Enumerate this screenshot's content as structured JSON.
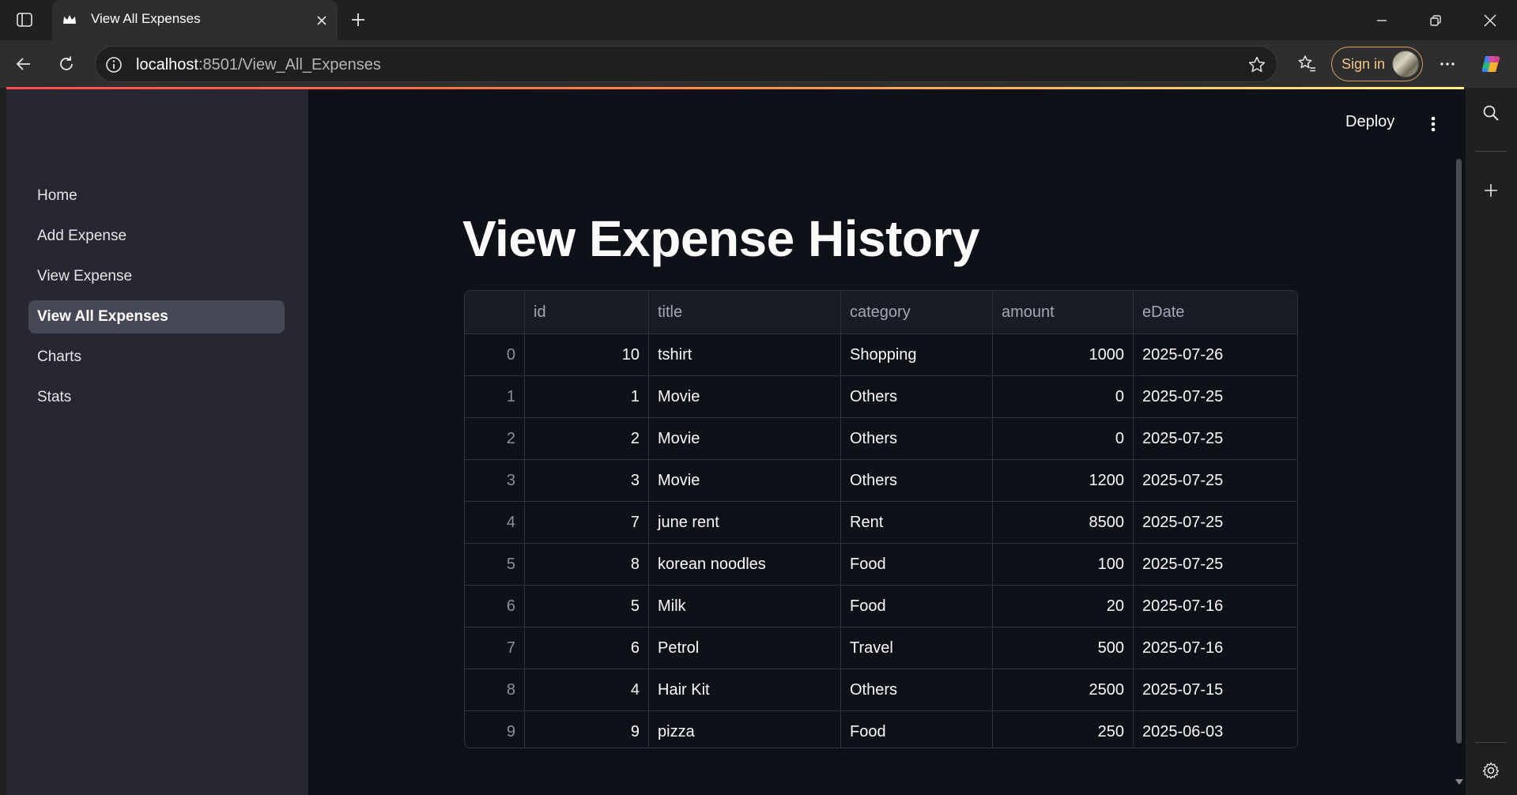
{
  "browser": {
    "tab_title": "View All Expenses",
    "url_host": "localhost",
    "url_path": ":8501/View_All_Expenses",
    "signin_label": "Sign in"
  },
  "app": {
    "sidebar": {
      "items": [
        {
          "label": "Home",
          "active": false
        },
        {
          "label": "Add Expense",
          "active": false
        },
        {
          "label": "View Expense",
          "active": false
        },
        {
          "label": "View All Expenses",
          "active": true
        },
        {
          "label": "Charts",
          "active": false
        },
        {
          "label": "Stats",
          "active": false
        }
      ]
    },
    "header": {
      "deploy_label": "Deploy"
    },
    "main": {
      "title": "View Expense History",
      "table": {
        "columns": [
          "",
          "id",
          "title",
          "category",
          "amount",
          "eDate"
        ],
        "rows": [
          [
            "0",
            "10",
            "tshirt",
            "Shopping",
            "1000",
            "2025-07-26"
          ],
          [
            "1",
            "1",
            "Movie",
            "Others",
            "0",
            "2025-07-25"
          ],
          [
            "2",
            "2",
            "Movie",
            "Others",
            "0",
            "2025-07-25"
          ],
          [
            "3",
            "3",
            "Movie",
            "Others",
            "1200",
            "2025-07-25"
          ],
          [
            "4",
            "7",
            "june rent",
            "Rent",
            "8500",
            "2025-07-25"
          ],
          [
            "5",
            "8",
            "korean noodles",
            "Food",
            "100",
            "2025-07-25"
          ],
          [
            "6",
            "5",
            "Milk",
            "Food",
            "20",
            "2025-07-16"
          ],
          [
            "7",
            "6",
            "Petrol",
            "Travel",
            "500",
            "2025-07-16"
          ],
          [
            "8",
            "4",
            "Hair Kit",
            "Others",
            "2500",
            "2025-07-15"
          ],
          [
            "9",
            "9",
            "pizza",
            "Food",
            "250",
            "2025-06-03"
          ]
        ]
      }
    }
  },
  "colors": {
    "accent_start": "#ff4b4b",
    "accent_end": "#fff27a",
    "app_background": "#0e1117",
    "sidebar_background": "#262730",
    "signin_accent": "#d9a15c"
  },
  "icons": [
    "tab-actions-icon",
    "streamlit-crown-icon",
    "close-icon",
    "plus-icon",
    "minimize-icon",
    "restore-icon",
    "back-icon",
    "refresh-icon",
    "info-icon",
    "star-icon",
    "favorites-icon",
    "more-icon",
    "copilot-icon",
    "search-icon",
    "settings-icon",
    "kebab-menu-icon"
  ]
}
